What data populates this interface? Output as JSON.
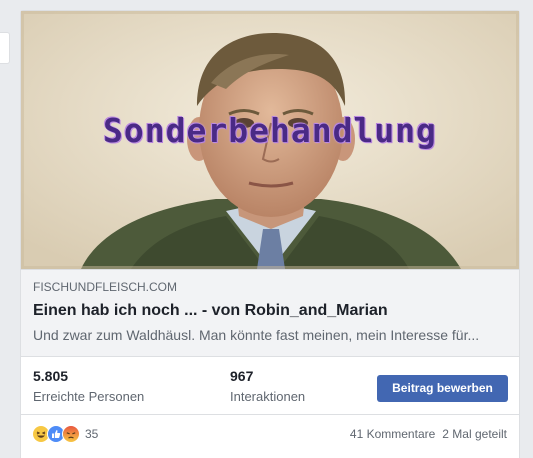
{
  "link_preview": {
    "image_caption": "Sonderbehandlung",
    "domain": "FISCHUNDFLEISCH.COM",
    "title": "Einen hab ich noch ... - von Robin_and_Marian",
    "description": "Und zwar zum Waldhäusl. Man könnte fast meinen, mein Interesse für..."
  },
  "stats": {
    "reach_value": "5.805",
    "reach_label": "Erreichte Personen",
    "interactions_value": "967",
    "interactions_label": "Interaktionen",
    "boost_label": "Beitrag bewerben"
  },
  "footer": {
    "reaction_icons": [
      "haha-icon",
      "like-icon",
      "angry-icon"
    ],
    "reaction_count": "35",
    "comments": "41 Kommentare",
    "shares": "2 Mal geteilt"
  },
  "colors": {
    "accent": "#4267b2",
    "caption": "#4a2a86"
  }
}
